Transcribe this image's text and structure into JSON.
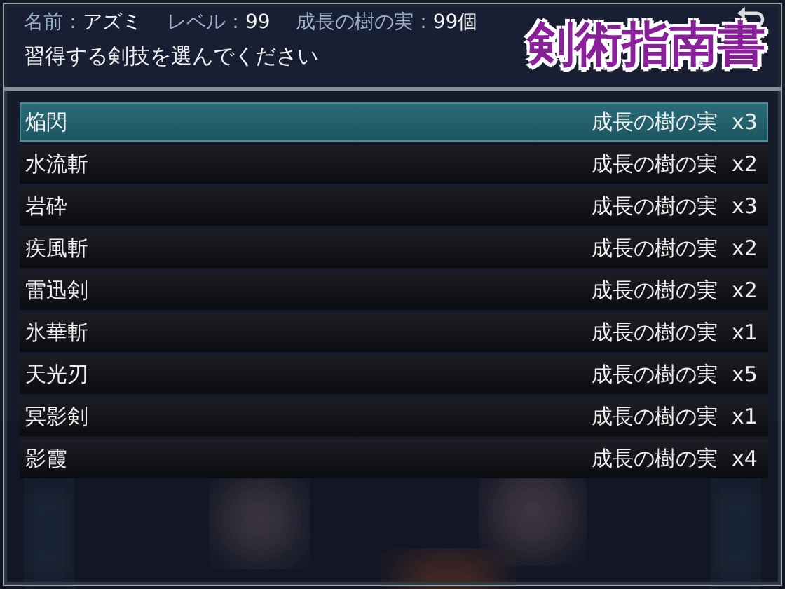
{
  "header": {
    "name_label": "名前：",
    "name": "アズミ",
    "level_label": "レベル：",
    "level": "99",
    "item_label": "成長の樹の実：",
    "item_count": "99個",
    "prompt": "習得する剣技を選んでください"
  },
  "title": "剣術指南書",
  "skills": [
    {
      "name": "焔閃",
      "cost": "成長の樹の実",
      "qty": "x3",
      "selected": true
    },
    {
      "name": "水流斬",
      "cost": "成長の樹の実",
      "qty": "x2",
      "selected": false
    },
    {
      "name": "岩砕",
      "cost": "成長の樹の実",
      "qty": "x3",
      "selected": false
    },
    {
      "name": "疾風斬",
      "cost": "成長の樹の実",
      "qty": "x2",
      "selected": false
    },
    {
      "name": "雷迅剣",
      "cost": "成長の樹の実",
      "qty": "x2",
      "selected": false
    },
    {
      "name": "氷華斬",
      "cost": "成長の樹の実",
      "qty": "x1",
      "selected": false
    },
    {
      "name": "天光刃",
      "cost": "成長の樹の実",
      "qty": "x5",
      "selected": false
    },
    {
      "name": "冥影剣",
      "cost": "成長の樹の実",
      "qty": "x1",
      "selected": false
    },
    {
      "name": "影霞",
      "cost": "成長の樹の実",
      "qty": "x4",
      "selected": false
    }
  ]
}
